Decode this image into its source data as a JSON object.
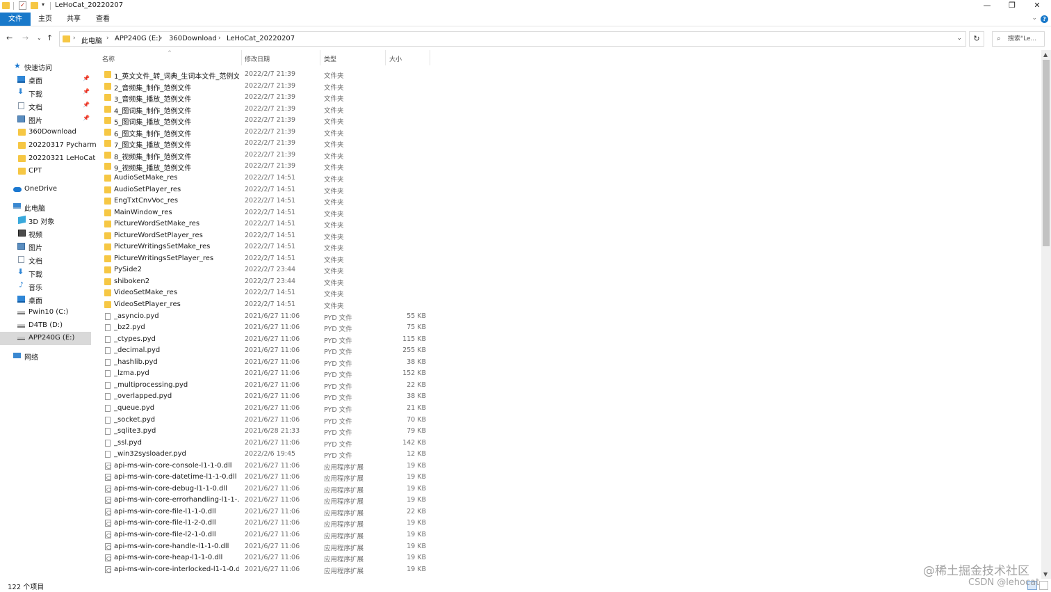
{
  "window": {
    "title": "LeHoCat_20220207",
    "controls": {
      "minimize": "—",
      "maximize": "❐",
      "close": "✕"
    }
  },
  "ribbon": {
    "tabs": [
      "文件",
      "主页",
      "共享",
      "查看"
    ],
    "help": "?"
  },
  "nav": {
    "back": "←",
    "forward": "→",
    "recent": "⌄",
    "up": "↑",
    "breadcrumb": [
      "此电脑",
      "APP240G (E:)",
      "360Download",
      "LeHoCat_20220207"
    ],
    "refresh": "↻",
    "search_placeholder": "搜索\"Le..."
  },
  "sidebar": {
    "quick_access": "快速访问",
    "quick_items": [
      {
        "label": "桌面",
        "icon": "desktop-icon",
        "pinned": true
      },
      {
        "label": "下载",
        "icon": "download-icon",
        "pinned": true
      },
      {
        "label": "文档",
        "icon": "document-icon",
        "pinned": true
      },
      {
        "label": "图片",
        "icon": "pictures-icon",
        "pinned": true
      },
      {
        "label": "360Download",
        "icon": "folder-icon",
        "pinned": false
      },
      {
        "label": "20220317 Pycharm",
        "icon": "folder-icon",
        "pinned": false
      },
      {
        "label": "20220321 LeHoCat",
        "icon": "folder-icon",
        "pinned": false
      },
      {
        "label": "CPT",
        "icon": "folder-icon",
        "pinned": false
      }
    ],
    "onedrive": "OneDrive",
    "this_pc": "此电脑",
    "pc_items": [
      {
        "label": "3D 对象",
        "icon": "3d-objects-icon"
      },
      {
        "label": "视频",
        "icon": "videos-icon"
      },
      {
        "label": "图片",
        "icon": "pictures-icon"
      },
      {
        "label": "文档",
        "icon": "document-icon"
      },
      {
        "label": "下载",
        "icon": "download-icon"
      },
      {
        "label": "音乐",
        "icon": "music-icon"
      },
      {
        "label": "桌面",
        "icon": "desktop-icon"
      },
      {
        "label": "Pwin10 (C:)",
        "icon": "drive-icon"
      },
      {
        "label": "D4TB (D:)",
        "icon": "drive-icon"
      },
      {
        "label": "APP240G (E:)",
        "icon": "drive-icon"
      }
    ],
    "network": "网络"
  },
  "columns": {
    "name": "名称",
    "date": "修改日期",
    "type": "类型",
    "size": "大小"
  },
  "files": [
    {
      "name": "1_英文文件_转_词典_生词本文件_范例文件",
      "date": "2022/2/7 21:39",
      "type": "文件夹",
      "size": "",
      "kind": "folder"
    },
    {
      "name": "2_音频集_制作_范例文件",
      "date": "2022/2/7 21:39",
      "type": "文件夹",
      "size": "",
      "kind": "folder"
    },
    {
      "name": "3_音频集_播放_范例文件",
      "date": "2022/2/7 21:39",
      "type": "文件夹",
      "size": "",
      "kind": "folder"
    },
    {
      "name": "4_图词集_制作_范例文件",
      "date": "2022/2/7 21:39",
      "type": "文件夹",
      "size": "",
      "kind": "folder"
    },
    {
      "name": "5_图词集_播放_范例文件",
      "date": "2022/2/7 21:39",
      "type": "文件夹",
      "size": "",
      "kind": "folder"
    },
    {
      "name": "6_图文集_制作_范例文件",
      "date": "2022/2/7 21:39",
      "type": "文件夹",
      "size": "",
      "kind": "folder"
    },
    {
      "name": "7_图文集_播放_范例文件",
      "date": "2022/2/7 21:39",
      "type": "文件夹",
      "size": "",
      "kind": "folder"
    },
    {
      "name": "8_视频集_制作_范例文件",
      "date": "2022/2/7 21:39",
      "type": "文件夹",
      "size": "",
      "kind": "folder"
    },
    {
      "name": "9_视频集_播放_范例文件",
      "date": "2022/2/7 21:39",
      "type": "文件夹",
      "size": "",
      "kind": "folder"
    },
    {
      "name": "AudioSetMake_res",
      "date": "2022/2/7 14:51",
      "type": "文件夹",
      "size": "",
      "kind": "folder"
    },
    {
      "name": "AudioSetPlayer_res",
      "date": "2022/2/7 14:51",
      "type": "文件夹",
      "size": "",
      "kind": "folder"
    },
    {
      "name": "EngTxtCnvVoc_res",
      "date": "2022/2/7 14:51",
      "type": "文件夹",
      "size": "",
      "kind": "folder"
    },
    {
      "name": "MainWindow_res",
      "date": "2022/2/7 14:51",
      "type": "文件夹",
      "size": "",
      "kind": "folder"
    },
    {
      "name": "PictureWordSetMake_res",
      "date": "2022/2/7 14:51",
      "type": "文件夹",
      "size": "",
      "kind": "folder"
    },
    {
      "name": "PictureWordSetPlayer_res",
      "date": "2022/2/7 14:51",
      "type": "文件夹",
      "size": "",
      "kind": "folder"
    },
    {
      "name": "PictureWritingsSetMake_res",
      "date": "2022/2/7 14:51",
      "type": "文件夹",
      "size": "",
      "kind": "folder"
    },
    {
      "name": "PictureWritingsSetPlayer_res",
      "date": "2022/2/7 14:51",
      "type": "文件夹",
      "size": "",
      "kind": "folder"
    },
    {
      "name": "PySide2",
      "date": "2022/2/7 23:44",
      "type": "文件夹",
      "size": "",
      "kind": "folder"
    },
    {
      "name": "shiboken2",
      "date": "2022/2/7 23:44",
      "type": "文件夹",
      "size": "",
      "kind": "folder"
    },
    {
      "name": "VideoSetMake_res",
      "date": "2022/2/7 14:51",
      "type": "文件夹",
      "size": "",
      "kind": "folder"
    },
    {
      "name": "VideoSetPlayer_res",
      "date": "2022/2/7 14:51",
      "type": "文件夹",
      "size": "",
      "kind": "folder"
    },
    {
      "name": "_asyncio.pyd",
      "date": "2021/6/27 11:06",
      "type": "PYD 文件",
      "size": "55 KB",
      "kind": "file"
    },
    {
      "name": "_bz2.pyd",
      "date": "2021/6/27 11:06",
      "type": "PYD 文件",
      "size": "75 KB",
      "kind": "file"
    },
    {
      "name": "_ctypes.pyd",
      "date": "2021/6/27 11:06",
      "type": "PYD 文件",
      "size": "115 KB",
      "kind": "file"
    },
    {
      "name": "_decimal.pyd",
      "date": "2021/6/27 11:06",
      "type": "PYD 文件",
      "size": "255 KB",
      "kind": "file"
    },
    {
      "name": "_hashlib.pyd",
      "date": "2021/6/27 11:06",
      "type": "PYD 文件",
      "size": "38 KB",
      "kind": "file"
    },
    {
      "name": "_lzma.pyd",
      "date": "2021/6/27 11:06",
      "type": "PYD 文件",
      "size": "152 KB",
      "kind": "file"
    },
    {
      "name": "_multiprocessing.pyd",
      "date": "2021/6/27 11:06",
      "type": "PYD 文件",
      "size": "22 KB",
      "kind": "file"
    },
    {
      "name": "_overlapped.pyd",
      "date": "2021/6/27 11:06",
      "type": "PYD 文件",
      "size": "38 KB",
      "kind": "file"
    },
    {
      "name": "_queue.pyd",
      "date": "2021/6/27 11:06",
      "type": "PYD 文件",
      "size": "21 KB",
      "kind": "file"
    },
    {
      "name": "_socket.pyd",
      "date": "2021/6/27 11:06",
      "type": "PYD 文件",
      "size": "70 KB",
      "kind": "file"
    },
    {
      "name": "_sqlite3.pyd",
      "date": "2021/6/28 21:33",
      "type": "PYD 文件",
      "size": "79 KB",
      "kind": "file"
    },
    {
      "name": "_ssl.pyd",
      "date": "2021/6/27 11:06",
      "type": "PYD 文件",
      "size": "142 KB",
      "kind": "file"
    },
    {
      "name": "_win32sysloader.pyd",
      "date": "2022/2/6 19:45",
      "type": "PYD 文件",
      "size": "12 KB",
      "kind": "file"
    },
    {
      "name": "api-ms-win-core-console-l1-1-0.dll",
      "date": "2021/6/27 11:06",
      "type": "应用程序扩展",
      "size": "19 KB",
      "kind": "dll"
    },
    {
      "name": "api-ms-win-core-datetime-l1-1-0.dll",
      "date": "2021/6/27 11:06",
      "type": "应用程序扩展",
      "size": "19 KB",
      "kind": "dll"
    },
    {
      "name": "api-ms-win-core-debug-l1-1-0.dll",
      "date": "2021/6/27 11:06",
      "type": "应用程序扩展",
      "size": "19 KB",
      "kind": "dll"
    },
    {
      "name": "api-ms-win-core-errorhandling-l1-1-...",
      "date": "2021/6/27 11:06",
      "type": "应用程序扩展",
      "size": "19 KB",
      "kind": "dll"
    },
    {
      "name": "api-ms-win-core-file-l1-1-0.dll",
      "date": "2021/6/27 11:06",
      "type": "应用程序扩展",
      "size": "22 KB",
      "kind": "dll"
    },
    {
      "name": "api-ms-win-core-file-l1-2-0.dll",
      "date": "2021/6/27 11:06",
      "type": "应用程序扩展",
      "size": "19 KB",
      "kind": "dll"
    },
    {
      "name": "api-ms-win-core-file-l2-1-0.dll",
      "date": "2021/6/27 11:06",
      "type": "应用程序扩展",
      "size": "19 KB",
      "kind": "dll"
    },
    {
      "name": "api-ms-win-core-handle-l1-1-0.dll",
      "date": "2021/6/27 11:06",
      "type": "应用程序扩展",
      "size": "19 KB",
      "kind": "dll"
    },
    {
      "name": "api-ms-win-core-heap-l1-1-0.dll",
      "date": "2021/6/27 11:06",
      "type": "应用程序扩展",
      "size": "19 KB",
      "kind": "dll"
    },
    {
      "name": "api-ms-win-core-interlocked-l1-1-0.dll",
      "date": "2021/6/27 11:06",
      "type": "应用程序扩展",
      "size": "19 KB",
      "kind": "dll"
    }
  ],
  "status": {
    "count": "122 个项目"
  },
  "watermark": {
    "line1": "@稀土掘金技术社区",
    "line2": "CSDN @lehocat"
  },
  "colors": {
    "accent": "#1979ca",
    "folder": "#f6c744",
    "selected_bg": "#d9d9d9"
  }
}
